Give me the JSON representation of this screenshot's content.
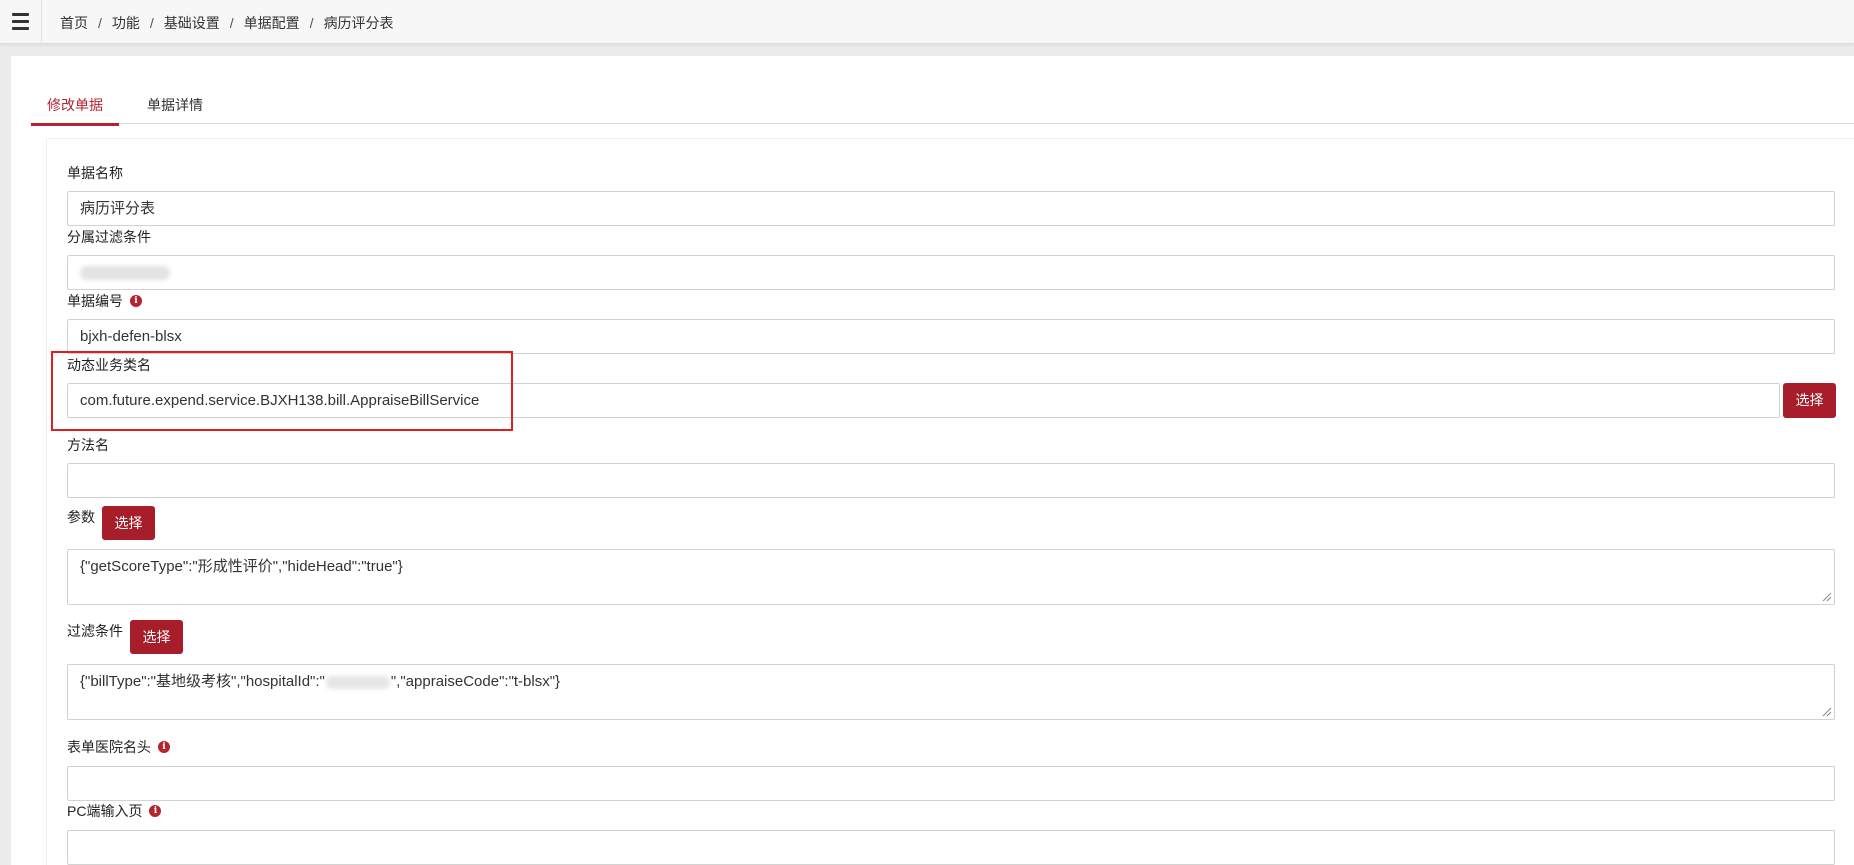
{
  "header": {
    "menu_icon": "hamburger-icon",
    "breadcrumb": [
      "首页",
      "功能",
      "基础设置",
      "单据配置",
      "病历评分表"
    ],
    "separator": "/"
  },
  "tabs": [
    {
      "label": "修改单据",
      "active": true
    },
    {
      "label": "单据详情",
      "active": false
    }
  ],
  "form": {
    "bill_name": {
      "label": "单据名称",
      "value": "病历评分表"
    },
    "filter_affiliation": {
      "label": "分属过滤条件",
      "value": ""
    },
    "bill_code": {
      "label": "单据编号",
      "value": "bjxh-defen-blsx"
    },
    "dynamic_service": {
      "label": "动态业务类名",
      "value": "com.future.expend.service.BJXH138.bill.AppraiseBillService",
      "button": "选择"
    },
    "method_name": {
      "label": "方法名",
      "value": ""
    },
    "params": {
      "label": "参数",
      "button": "选择",
      "value": "{\"getScoreType\":\"形成性评价\",\"hideHead\":\"true\"}"
    },
    "filter_condition": {
      "label": "过滤条件",
      "button": "选择",
      "value_prefix": "{\"billType\":\"基地级考核\",\"hospitalId\":\"",
      "value_suffix": "\",\"appraiseCode\":\"t-blsx\"}"
    },
    "hospital_header": {
      "label": "表单医院名头",
      "value": ""
    },
    "pc_input_page": {
      "label": "PC端输入页",
      "value": ""
    }
  },
  "colors": {
    "accent": "#a71d2a",
    "tab_active": "#b5232f",
    "annotation": "#e02020"
  }
}
